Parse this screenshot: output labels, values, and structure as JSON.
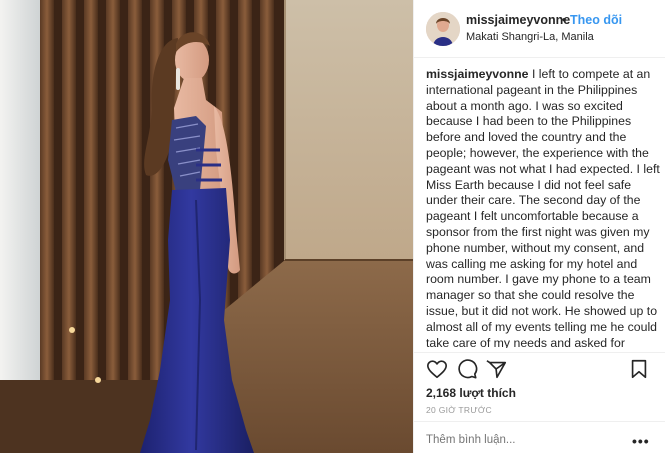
{
  "post": {
    "username": "missjaimeyvonne",
    "separator": "•",
    "follow_label": "Theo dõi",
    "location": "Makati Shangri-La, Manila",
    "caption_text": "I left to compete at an international pageant in the Philippines about a month ago. I was so excited because I had been to the Philippines before and loved the country and the people; however, the experience with the pageant was not what I had expected. I left Miss Earth because I did not feel safe under their care. The second day of the pageant I felt uncomfortable because a sponsor from the first night was given my phone number, without my consent, and was calling me asking for my hotel and room number. I gave my phone to a team manager so that she could resolve the issue, but it did not work. He showed up to almost all of my events telling me he could take care of my needs and asked for sexual favours in exchange to get me further in the pageant. I was disgusted. He showed up to a hotel some girls were staying at and when I went to his room I was so uncomfortable",
    "likes": "2,168 lượt thích",
    "timestamp": "20 GIỜ TRƯỚC",
    "comment_placeholder": "Thêm bình luận...",
    "more_label": "•••"
  },
  "icons": {
    "like": "heart-icon",
    "comment": "comment-bubble-icon",
    "share": "share-arrow-icon",
    "save": "bookmark-icon"
  },
  "colors": {
    "follow": "#3897f0",
    "text": "#262626",
    "muted": "#999999",
    "gown": "#2a2f86"
  }
}
